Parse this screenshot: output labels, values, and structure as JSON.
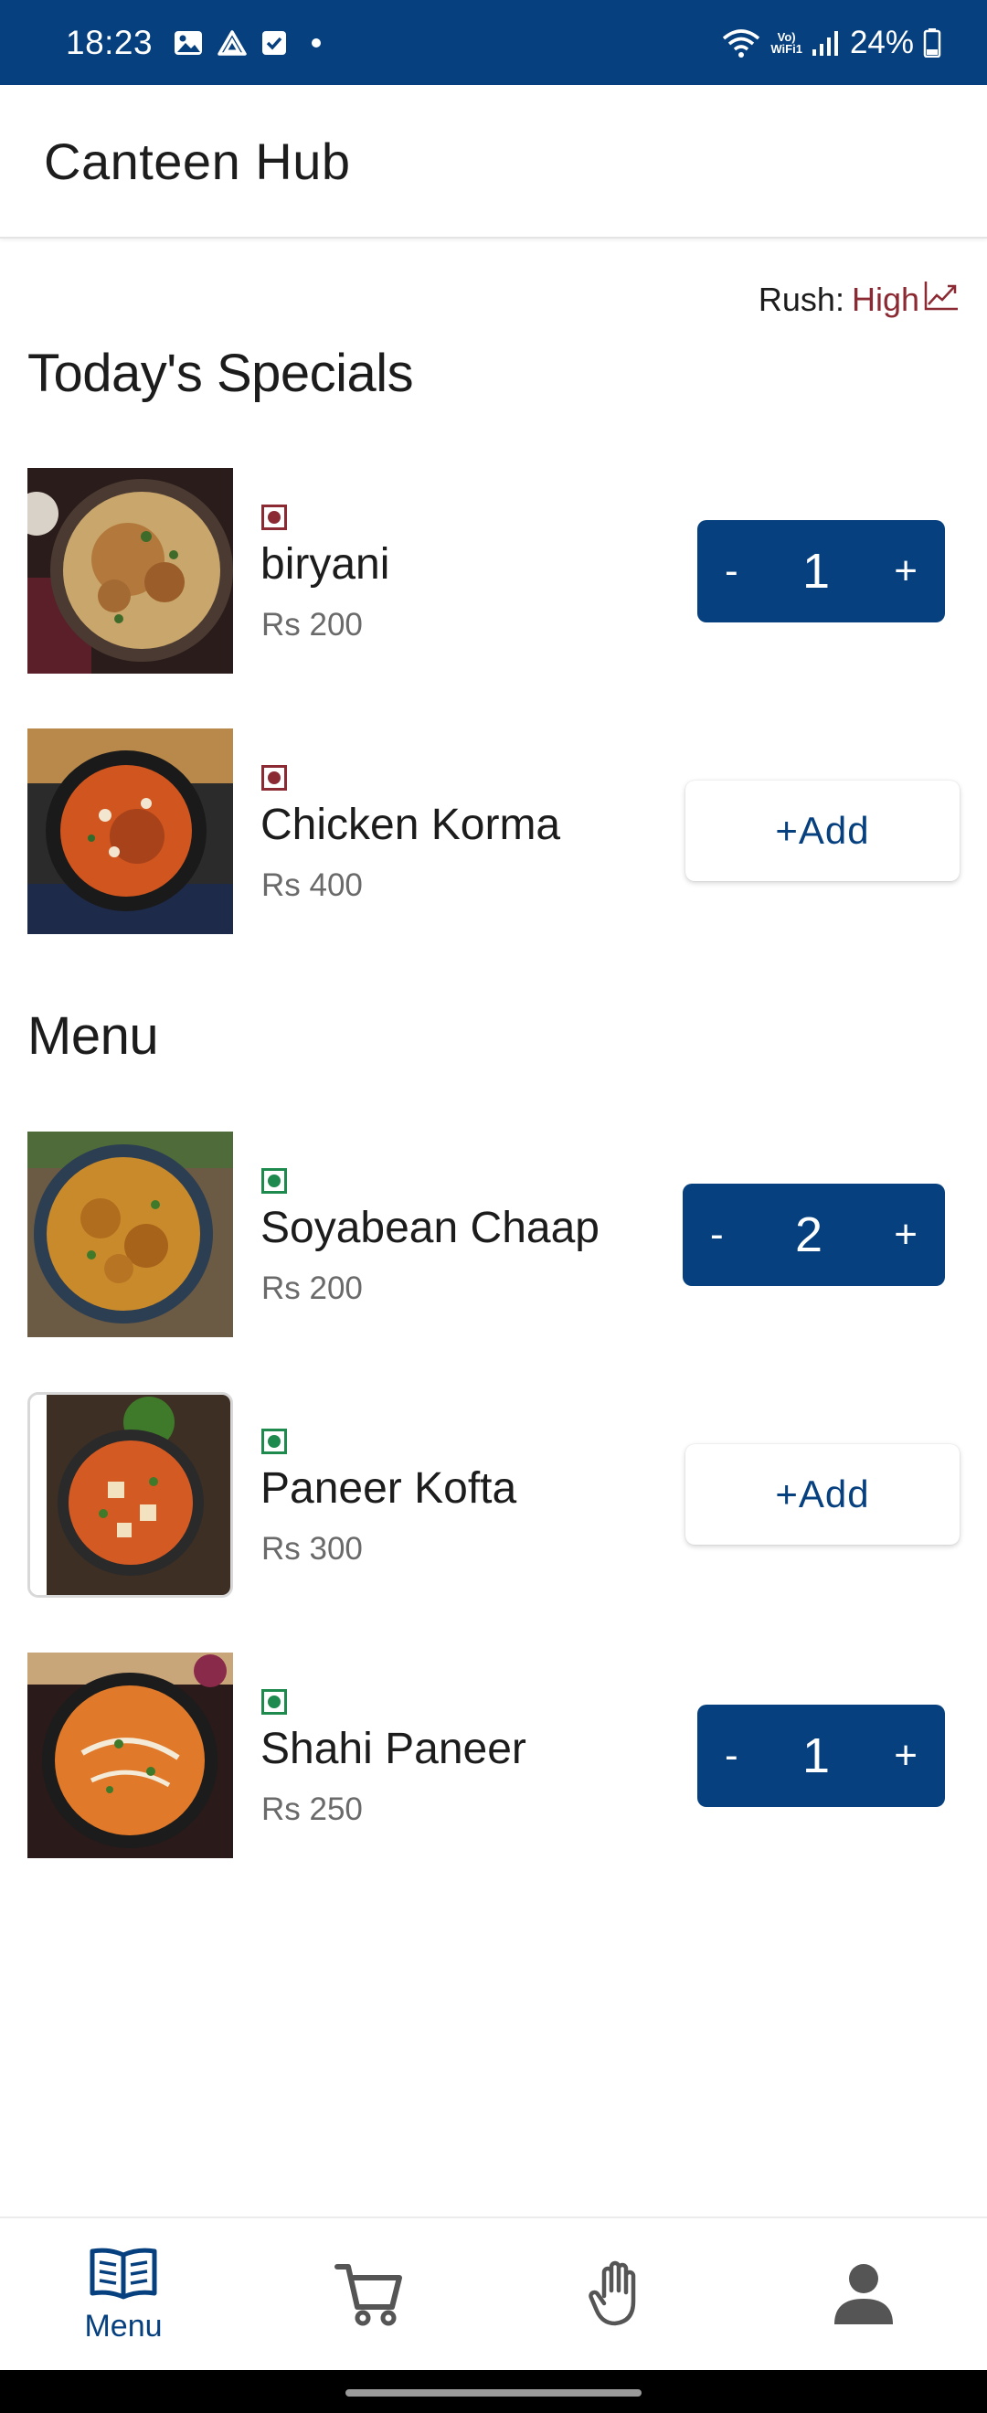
{
  "status_bar": {
    "time": "18:23",
    "battery": "24%",
    "vowifi_top": "Vo)",
    "vowifi_bottom": "WiFi1"
  },
  "app": {
    "title": "Canteen Hub"
  },
  "rush": {
    "label": "Rush:",
    "value": "High",
    "value_color": "#8b2a33"
  },
  "sections": {
    "specials_title": "Today's Specials",
    "menu_title": "Menu"
  },
  "specials": [
    {
      "name": "biryani",
      "price": "Rs 200",
      "type": "non-veg",
      "quantity": "1",
      "minus": "-",
      "plus": "+"
    },
    {
      "name": "Chicken Korma",
      "price": "Rs 400",
      "type": "non-veg",
      "add_label": "+Add"
    }
  ],
  "menu": [
    {
      "name": "Soyabean Chaap",
      "price": "Rs 200",
      "type": "veg",
      "quantity": "2",
      "minus": "-",
      "plus": "+"
    },
    {
      "name": "Paneer Kofta",
      "price": "Rs 300",
      "type": "veg",
      "add_label": "+Add"
    },
    {
      "name": "Shahi Paneer",
      "price": "Rs 250",
      "type": "veg",
      "quantity": "1",
      "minus": "-",
      "plus": "+"
    }
  ],
  "bottom_nav": {
    "items": [
      {
        "label": "Menu",
        "icon": "book-icon",
        "active": true
      },
      {
        "label": "",
        "icon": "cart-icon",
        "active": false
      },
      {
        "label": "",
        "icon": "hand-icon",
        "active": false
      },
      {
        "label": "",
        "icon": "person-icon",
        "active": false
      }
    ]
  },
  "colors": {
    "primary": "#06407f",
    "non_veg": "#8b2a33",
    "veg": "#1e8a4d"
  }
}
